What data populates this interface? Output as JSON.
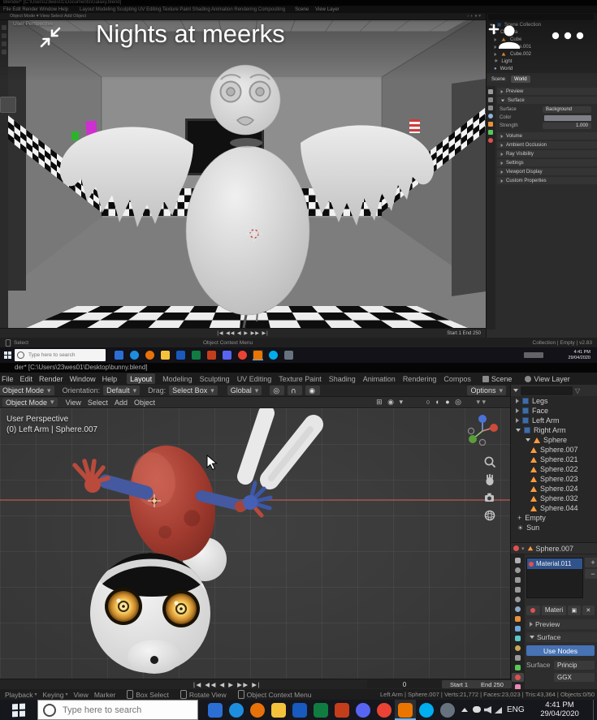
{
  "overlay": {
    "title": "Nights at meerks"
  },
  "screen1": {
    "titlebar": "Blender* [C:\\Users\\23wes01\\Documents\\Galaxy.blend]",
    "menus": "File    Edit    Render    Window    Help",
    "tabs": "Layout    Modeling    Sculpting    UV Editing    Texture Paint    Shading    Animation    Rendering    Compositing",
    "scene_label": "Scene",
    "view_layer_label": "View Layer",
    "header2": "Object Mode ▾      View    Select    Add    Object",
    "viewport_label": "User Perspective",
    "outliner_rows": [
      "Scene Collection",
      "Camera",
      "Cube",
      "Cube.001",
      "Cube.002",
      "Light",
      "World"
    ],
    "props": {
      "tab_scene": "Scene",
      "tab_world": "World",
      "row_preview": "Preview",
      "row_surface": "Surface",
      "surface_label": "Surface",
      "surface_value": "Background",
      "color_label": "Color",
      "strength_label": "Strength",
      "strength_value": "1.000",
      "row_volume": "Volume",
      "row_ao": "Ambient Occlusion",
      "row_ray": "Ray Visibility",
      "row_settings": "Settings",
      "row_viewport": "Viewport Display",
      "row_custom": "Custom Properties"
    },
    "transport": "|◀  ◀◀  ◀  ▶  ▶▶  ▶|",
    "timeline_fields": "Start 1     End 250",
    "status_left": "Select",
    "status_center": "Object Context Menu",
    "status_right": "Collection | Empty | v2.83",
    "taskbar": {
      "search": "Type here to search",
      "time": "4:41 PM",
      "date": "29/04/2020"
    }
  },
  "screen2": {
    "titlebar": "der* [C:\\Users\\23wes01\\Desktop\\bunny.blend]",
    "menus": [
      "File",
      "Edit",
      "Render",
      "Window",
      "Help"
    ],
    "tabs": [
      "Layout",
      "Modeling",
      "Sculpting",
      "UV Editing",
      "Texture Paint",
      "Shading",
      "Animation",
      "Rendering",
      "Compos"
    ],
    "scene_label": "Scene",
    "view_layer_label": "View Layer",
    "toolrow": {
      "mode": "Object Mode",
      "orientation_label": "Orientation:",
      "orientation_value": "Default",
      "drag_label": "Drag:",
      "drag_value": "Select Box",
      "transform_value": "Global",
      "options": "Options"
    },
    "header": {
      "mode": "Object Mode",
      "menus": [
        "View",
        "Select",
        "Add",
        "Object"
      ]
    },
    "viewport": {
      "perspective": "User Perspective",
      "active": "(0) Left Arm | Sphere.007"
    },
    "outliner_rows": [
      {
        "label": "Legs",
        "type": "collection"
      },
      {
        "label": "Face",
        "type": "collection"
      },
      {
        "label": "Left Arm",
        "type": "collection"
      },
      {
        "label": "Right Arm",
        "type": "collection"
      },
      {
        "label": "Sphere",
        "type": "mesh"
      },
      {
        "label": "Sphere.007",
        "type": "mesh"
      },
      {
        "label": "Sphere.021",
        "type": "mesh"
      },
      {
        "label": "Sphere.022",
        "type": "mesh"
      },
      {
        "label": "Sphere.023",
        "type": "mesh"
      },
      {
        "label": "Sphere.024",
        "type": "mesh"
      },
      {
        "label": "Sphere.032",
        "type": "mesh"
      },
      {
        "label": "Sphere.044",
        "type": "mesh"
      },
      {
        "label": "Empty",
        "type": "empty"
      },
      {
        "label": "Sun",
        "type": "light"
      }
    ],
    "props": {
      "breadcrumb": "Sphere.007",
      "slot": "Material.011",
      "browse": "Materi",
      "row_preview": "Preview",
      "row_surface": "Surface",
      "use_nodes": "Use Nodes",
      "surface_label": "Surface",
      "surface_value": "Princip",
      "ggx": "GGX"
    },
    "transport": "|◀  ◀◀  ◀  ▶  ▶▶  ▶|",
    "frame": "0",
    "start_field": "Start      1",
    "end_field": "End      250",
    "status": {
      "menus": [
        "Playback",
        "Keying",
        "View",
        "Marker"
      ],
      "hint1": "Box Select",
      "hint2": "Rotate View",
      "center": "Object Context Menu",
      "right": "Left Arm | Sphere.007 | Verts:21,772 | Faces:23,023 | Tris:43,364 | Objects:0/50"
    }
  },
  "taskbar": {
    "search": "Type here to search",
    "apps": [
      {
        "name": "mail",
        "color": "#2b6fd4"
      },
      {
        "name": "edge",
        "color": "#1d8ede"
      },
      {
        "name": "firefox",
        "color": "#e8710a"
      },
      {
        "name": "file-explorer",
        "color": "#f5c33b"
      },
      {
        "name": "word",
        "color": "#185abd"
      },
      {
        "name": "excel",
        "color": "#107c41"
      },
      {
        "name": "powerpoint",
        "color": "#c43e1c"
      },
      {
        "name": "discord",
        "color": "#5865f2"
      },
      {
        "name": "chrome",
        "color": "#ea4335"
      },
      {
        "name": "blender",
        "color": "#ea7600"
      },
      {
        "name": "skype",
        "color": "#00adef"
      },
      {
        "name": "steam",
        "color": "#66737e"
      }
    ],
    "lang": "ENG",
    "time": "4:41 PM",
    "date": "29/04/2020"
  },
  "colors": {
    "accent": "#4772b3",
    "mesh_icon": "#ff9b3c"
  }
}
